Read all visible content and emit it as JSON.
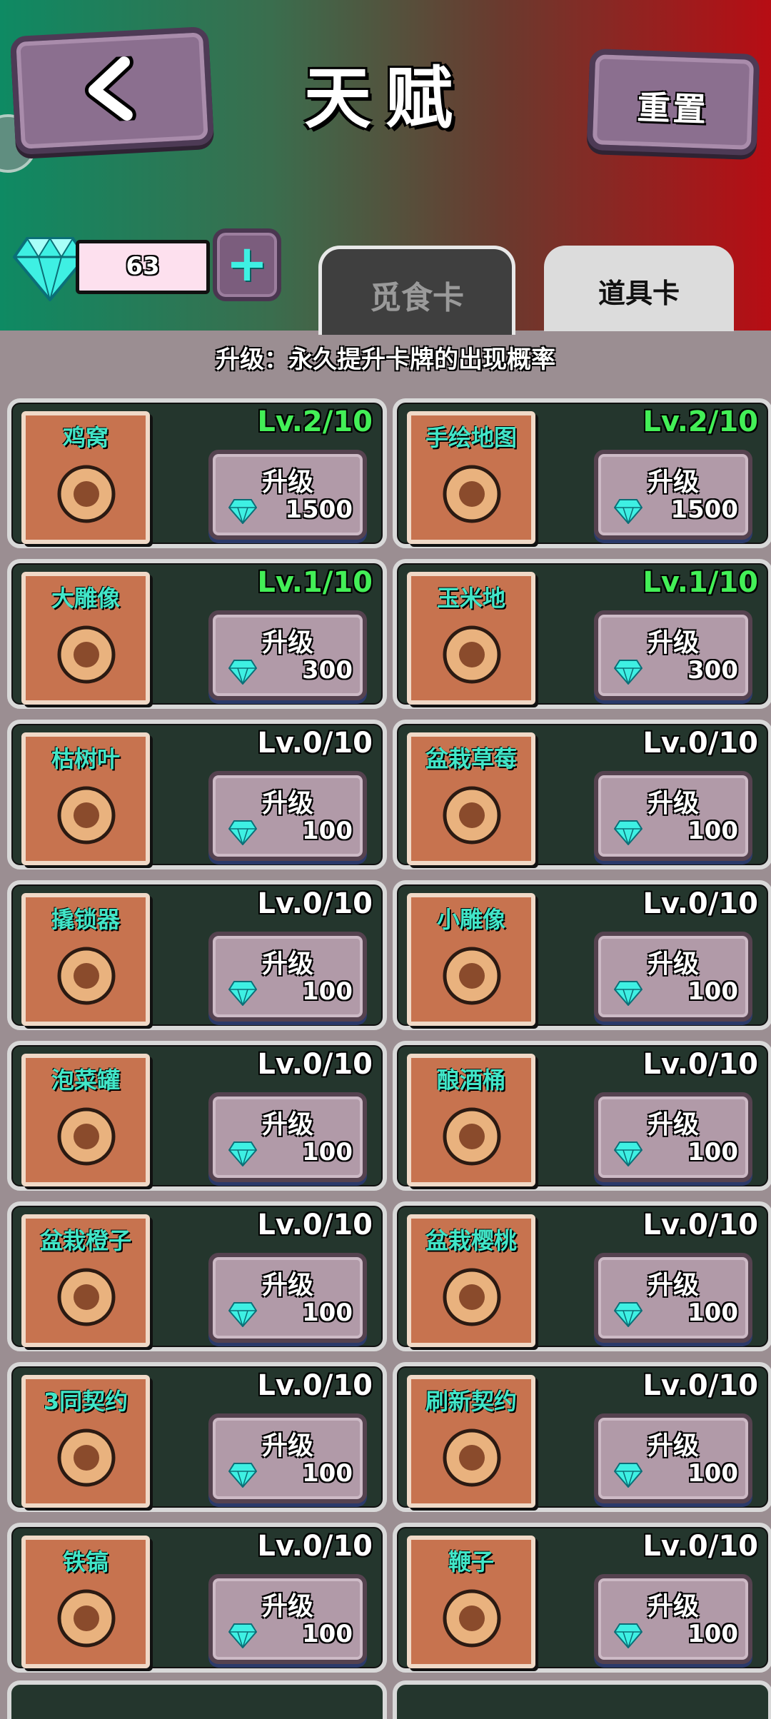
{
  "header": {
    "title": "天赋",
    "reset_label": "重置",
    "back_icon": "chevron-left-icon"
  },
  "balance": {
    "gems": "63"
  },
  "tabs": [
    {
      "label": "觅食卡",
      "selected": false
    },
    {
      "label": "道具卡",
      "selected": true
    }
  ],
  "subtitle": "升级：永久提升卡牌的出现概率",
  "upgrade_label": "升级",
  "cards": [
    {
      "name": "鸡窝",
      "level": "Lv.2/10",
      "cost": "1500",
      "icon": "chicken-coop-icon",
      "highlight": true
    },
    {
      "name": "手绘地图",
      "level": "Lv.2/10",
      "cost": "1500",
      "icon": "map-icon",
      "highlight": true
    },
    {
      "name": "大雕像",
      "level": "Lv.1/10",
      "cost": "300",
      "icon": "buddha-statue-icon",
      "highlight": true
    },
    {
      "name": "玉米地",
      "level": "Lv.1/10",
      "cost": "300",
      "icon": "corn-field-icon",
      "highlight": true
    },
    {
      "name": "枯树叶",
      "level": "Lv.0/10",
      "cost": "100",
      "icon": "dry-leaves-icon",
      "highlight": false
    },
    {
      "name": "盆栽草莓",
      "level": "Lv.0/10",
      "cost": "100",
      "icon": "potted-strawberry-icon",
      "highlight": false
    },
    {
      "name": "撬锁器",
      "level": "Lv.0/10",
      "cost": "100",
      "icon": "lockpick-icon",
      "highlight": false
    },
    {
      "name": "小雕像",
      "level": "Lv.0/10",
      "cost": "100",
      "icon": "small-statue-icon",
      "highlight": false
    },
    {
      "name": "泡菜罐",
      "level": "Lv.0/10",
      "cost": "100",
      "icon": "pickle-jar-icon",
      "highlight": false
    },
    {
      "name": "酿酒桶",
      "level": "Lv.0/10",
      "cost": "100",
      "icon": "wine-barrel-icon",
      "highlight": false
    },
    {
      "name": "盆栽橙子",
      "level": "Lv.0/10",
      "cost": "100",
      "icon": "potted-orange-icon",
      "highlight": false
    },
    {
      "name": "盆栽樱桃",
      "level": "Lv.0/10",
      "cost": "100",
      "icon": "potted-cherry-icon",
      "highlight": false
    },
    {
      "name": "3同契约",
      "level": "Lv.0/10",
      "cost": "100",
      "icon": "triple-check-scroll-icon",
      "highlight": false
    },
    {
      "name": "刷新契约",
      "level": "Lv.0/10",
      "cost": "100",
      "icon": "refresh-scroll-icon",
      "highlight": false
    },
    {
      "name": "铁镐",
      "level": "Lv.0/10",
      "cost": "100",
      "icon": "pickaxe-icon",
      "highlight": false
    },
    {
      "name": "鞭子",
      "level": "Lv.0/10",
      "cost": "100",
      "icon": "whip-icon",
      "highlight": false
    }
  ],
  "colors": {
    "header_left": "#0e8a63",
    "header_right": "#b70d14",
    "card_bg": "#24362d",
    "name_color": "#41e6c8",
    "level_highlight": "#43ef57",
    "gem": "#3ef0e3"
  }
}
